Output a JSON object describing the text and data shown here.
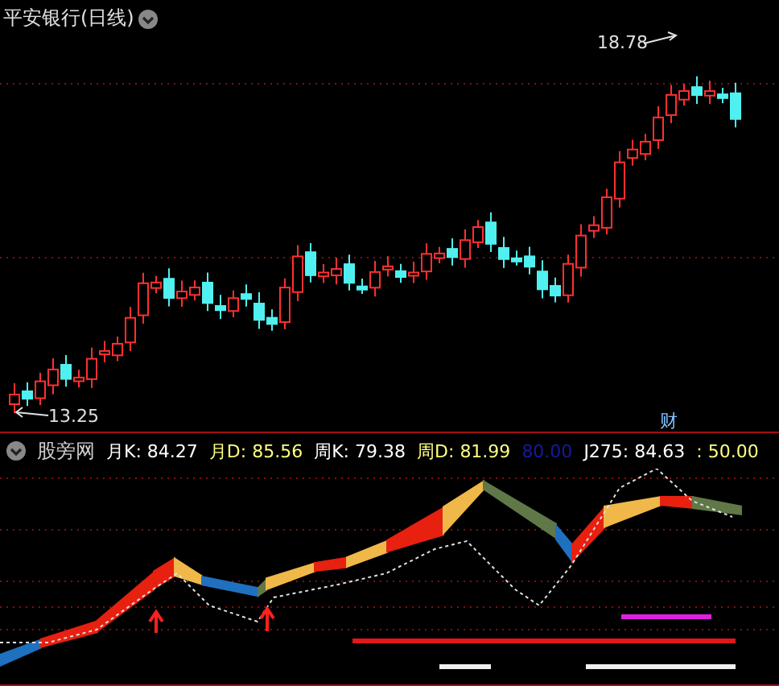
{
  "price_panel": {
    "title": "平安银行(日线)",
    "high_label": "18.78",
    "low_label": "13.25",
    "event_marker": "财"
  },
  "indicator_panel": {
    "name": "股旁网",
    "values": [
      {
        "text": "月K: 84.27",
        "color": "#ffffff"
      },
      {
        "text": "月D: 85.56",
        "color": "#ffff80"
      },
      {
        "text": "周K: 79.38",
        "color": "#ffffff"
      },
      {
        "text": "周D: 81.99",
        "color": "#ffff80"
      },
      {
        "text": "80.00",
        "color": "#1818a0"
      },
      {
        "text": "J275: 84.63",
        "color": "#ffffff"
      },
      {
        "text": ": 50.00",
        "color": "#ffff80"
      }
    ]
  }
}
